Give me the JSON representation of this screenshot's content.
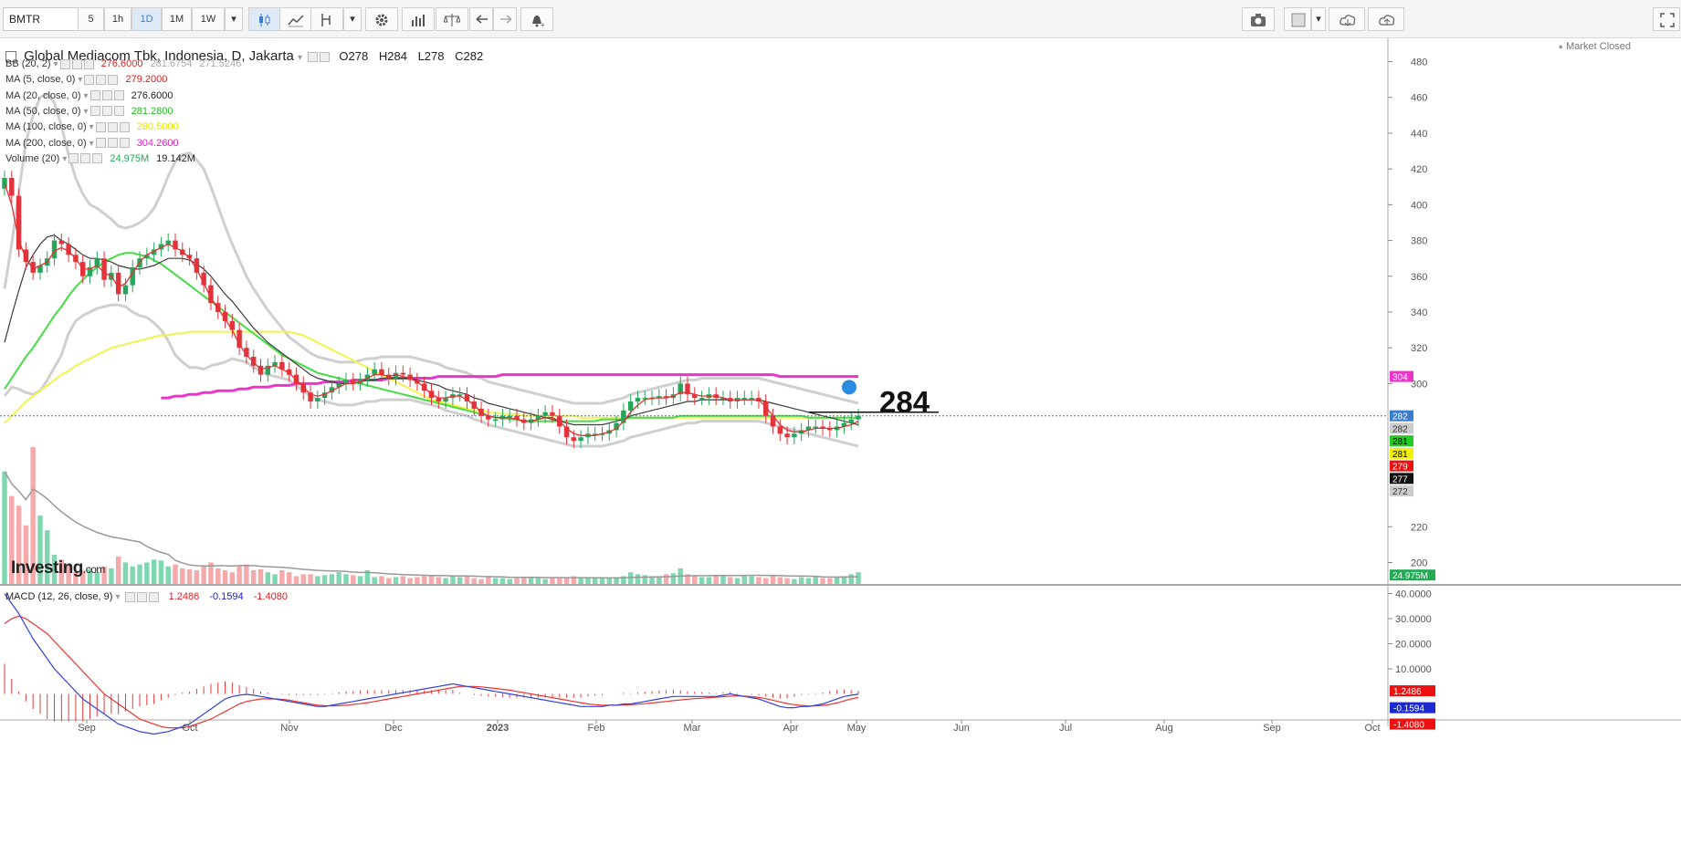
{
  "toolbar": {
    "symbol": "BMTR",
    "intervals": [
      "5",
      "1h",
      "1D",
      "1M",
      "1W"
    ],
    "active_interval": "1D",
    "icons": [
      "candles-icon",
      "line-chart-icon",
      "indicator-icon",
      "settings-icon",
      "studies-icon",
      "compare-icon",
      "undo-icon",
      "redo-icon",
      "alert-icon",
      "camera-icon",
      "color-box-icon",
      "cloud-download-icon",
      "cloud-upload-icon",
      "fullscreen-icon"
    ]
  },
  "header": {
    "title": "Global Mediacom Tbk, Indonesia, D, Jakarta",
    "open": "O278",
    "high": "H284",
    "low": "L278",
    "close": "C282",
    "market_status": "Market Closed"
  },
  "legends": [
    {
      "name": "BB (20, 2)",
      "values": [
        {
          "text": "276.6000",
          "color": "#d82020"
        },
        {
          "text": "281.6754",
          "color": "#aaaaaa"
        },
        {
          "text": "271.5246",
          "color": "#aaaaaa"
        }
      ]
    },
    {
      "name": "MA (5, close, 0)",
      "values": [
        {
          "text": "279.2000",
          "color": "#d82020"
        }
      ]
    },
    {
      "name": "MA (20, close, 0)",
      "values": [
        {
          "text": "276.6000",
          "color": "#222222"
        }
      ]
    },
    {
      "name": "MA (50, close, 0)",
      "values": [
        {
          "text": "281.2800",
          "color": "#22bb22"
        }
      ]
    },
    {
      "name": "MA (100, close, 0)",
      "values": [
        {
          "text": "280.5000",
          "color": "#e6e600"
        }
      ]
    },
    {
      "name": "MA (200, close, 0)",
      "values": [
        {
          "text": "304.2600",
          "color": "#e020c0"
        }
      ]
    },
    {
      "name": "Volume (20)",
      "values": [
        {
          "text": "24.975M",
          "color": "#22aa55"
        },
        {
          "text": "19.142M",
          "color": "#222222"
        }
      ]
    }
  ],
  "macd_legend": {
    "name": "MACD (12, 26, close, 9)",
    "values": [
      {
        "text": "1.2486",
        "color": "#d82020"
      },
      {
        "text": "-0.1594",
        "color": "#2020d0"
      },
      {
        "text": "-1.4080",
        "color": "#d82020"
      }
    ]
  },
  "logo": {
    "main": "Investing",
    "suffix": ".com"
  },
  "annotation": {
    "text": "284",
    "level": 284
  },
  "colors": {
    "up": "#26a65b",
    "down": "#e2343c",
    "ma5": "#e53030",
    "ma20": "#3a3a3a",
    "ma50": "#44dd44",
    "ma100": "#f3f34d",
    "ma200": "#ee33cc",
    "bb": "#cfcfcf",
    "macd": "#3344dd",
    "signal": "#ee3333",
    "vol_up": "#7fd7b0",
    "vol_down": "#f6a9ab",
    "vol_ma": "#999999"
  },
  "chart_data": {
    "type": "candlestick",
    "x_ticks": [
      "Sep",
      "Oct",
      "Nov",
      "Dec",
      "2023",
      "Feb",
      "Mar",
      "Apr",
      "May",
      "Jun",
      "Jul",
      "Aug",
      "Sep",
      "Oct"
    ],
    "price_ticks": [
      480,
      460,
      440,
      420,
      400,
      380,
      360,
      340,
      320,
      300,
      282,
      220,
      200
    ],
    "price_range": [
      188,
      492
    ],
    "macd_ticks": [
      "40.0000",
      "30.0000",
      "20.0000",
      "10.0000"
    ],
    "macd_range": [
      -10,
      42
    ],
    "price_badges": [
      {
        "text": "304",
        "value": 304,
        "bg": "#ee33cc",
        "fg": "#ffffff"
      },
      {
        "text": "282",
        "value": 282,
        "bg": "#3b7ccb",
        "fg": "#ffffff"
      },
      {
        "text": "282",
        "value": 275,
        "bg": "#cccccc",
        "fg": "#333333"
      },
      {
        "text": "281",
        "value": 268,
        "bg": "#22cc22",
        "fg": "#000000"
      },
      {
        "text": "281",
        "value": 261,
        "bg": "#f0f000",
        "fg": "#000000"
      },
      {
        "text": "279",
        "value": 254,
        "bg": "#ee1111",
        "fg": "#ffffff"
      },
      {
        "text": "277",
        "value": 247,
        "bg": "#111111",
        "fg": "#ffffff"
      },
      {
        "text": "272",
        "value": 240,
        "bg": "#cccccc",
        "fg": "#333333"
      },
      {
        "text": "24.975M",
        "value": 193,
        "bg": "#22aa55",
        "fg": "#ffffff"
      }
    ],
    "macd_badges": [
      {
        "text": "1.2486",
        "value": 1.2486,
        "bg": "#ee1111",
        "fg": "#ffffff"
      },
      {
        "text": "-0.1594",
        "value": -5.5,
        "bg": "#1a2ad0",
        "fg": "#ffffff"
      },
      {
        "text": "-1.4080",
        "value": -12,
        "bg": "#ee1111",
        "fg": "#ffffff"
      }
    ],
    "close_prices": [
      415,
      405,
      375,
      368,
      362,
      366,
      370,
      380,
      378,
      372,
      368,
      360,
      365,
      370,
      358,
      362,
      350,
      355,
      365,
      370,
      372,
      375,
      378,
      380,
      375,
      372,
      370,
      362,
      355,
      345,
      340,
      335,
      330,
      320,
      315,
      310,
      305,
      310,
      312,
      308,
      305,
      300,
      295,
      290,
      292,
      295,
      298,
      300,
      302,
      300,
      302,
      305,
      308,
      305,
      303,
      306,
      305,
      302,
      300,
      296,
      292,
      290,
      292,
      294,
      294,
      290,
      286,
      282,
      280,
      280,
      282,
      282,
      280,
      278,
      280,
      282,
      284,
      282,
      276,
      270,
      268,
      270,
      272,
      272,
      272,
      274,
      278,
      285,
      290,
      292,
      292,
      292,
      293,
      292,
      294,
      300,
      294,
      292,
      292,
      294,
      292,
      292,
      290,
      292,
      292,
      292,
      290,
      282,
      276,
      272,
      270,
      272,
      274,
      276,
      276,
      275,
      274,
      276,
      278,
      280,
      282
    ],
    "volumes_m": [
      115,
      90,
      80,
      60,
      140,
      70,
      55,
      30,
      25,
      20,
      12,
      14,
      15,
      12,
      18,
      16,
      28,
      22,
      18,
      20,
      22,
      25,
      24,
      18,
      20,
      16,
      15,
      14,
      18,
      22,
      16,
      14,
      12,
      18,
      20,
      14,
      15,
      12,
      10,
      14,
      12,
      8,
      10,
      10,
      8,
      9,
      10,
      12,
      10,
      9,
      8,
      14,
      7,
      8,
      6,
      7,
      8,
      6,
      7,
      8,
      9,
      7,
      6,
      8,
      7,
      8,
      6,
      5,
      7,
      6,
      6,
      5,
      6,
      7,
      6,
      6,
      5,
      6,
      6,
      7,
      8,
      7,
      6,
      6,
      6,
      6,
      7,
      8,
      12,
      10,
      9,
      8,
      8,
      10,
      11,
      16,
      10,
      8,
      7,
      7,
      9,
      8,
      7,
      6,
      9,
      8,
      7,
      6,
      9,
      7,
      6,
      5,
      7,
      6,
      8,
      6,
      6,
      7,
      8,
      10,
      12
    ],
    "ma5": [
      412,
      400,
      380,
      370,
      364,
      366,
      368,
      374,
      376,
      374,
      370,
      364,
      364,
      366,
      362,
      360,
      354,
      356,
      362,
      368,
      372,
      374,
      376,
      378,
      376,
      374,
      370,
      364,
      356,
      348,
      342,
      336,
      330,
      322,
      316,
      312,
      308,
      309,
      310,
      308,
      306,
      302,
      298,
      294,
      293,
      294,
      296,
      298,
      300,
      300,
      301,
      303,
      305,
      305,
      304,
      305,
      304,
      303,
      301,
      298,
      294,
      292,
      292,
      293,
      293,
      291,
      288,
      284,
      282,
      281,
      281,
      281,
      280,
      279,
      279,
      280,
      281,
      281,
      279,
      275,
      272,
      271,
      271,
      271,
      272,
      273,
      275,
      279,
      284,
      288,
      291,
      292,
      292,
      292,
      293,
      295,
      295,
      294,
      293,
      293,
      293,
      292,
      291,
      291,
      291,
      291,
      291,
      287,
      282,
      277,
      274,
      273,
      273,
      274,
      275,
      275,
      275,
      275,
      276,
      277,
      279
    ],
    "ma20": [
      323,
      338,
      352,
      365,
      372,
      378,
      382,
      383,
      380,
      378,
      375,
      372,
      370,
      370,
      369,
      368,
      366,
      365,
      364,
      364,
      365,
      366,
      368,
      370,
      370,
      370,
      369,
      367,
      364,
      360,
      355,
      350,
      346,
      341,
      336,
      331,
      327,
      323,
      320,
      317,
      314,
      311,
      308,
      305,
      303,
      302,
      301,
      300,
      300,
      300,
      301,
      302,
      302,
      303,
      303,
      303,
      303,
      303,
      302,
      301,
      300,
      299,
      297,
      296,
      295,
      294,
      292,
      291,
      289,
      288,
      287,
      286,
      285,
      284,
      283,
      282,
      281,
      280,
      279,
      278,
      277,
      277,
      277,
      277,
      277,
      278,
      279,
      280,
      282,
      283,
      284,
      285,
      286,
      287,
      288,
      289,
      290,
      290,
      291,
      291,
      291,
      291,
      291,
      291,
      291,
      291,
      291,
      290,
      289,
      288,
      287,
      286,
      285,
      284,
      283,
      282,
      281,
      280,
      279,
      278,
      277
    ],
    "ma50": [
      297,
      303,
      309,
      315,
      320,
      326,
      332,
      338,
      343,
      349,
      354,
      358,
      362,
      365,
      368,
      370,
      372,
      373,
      373,
      372,
      371,
      369,
      367,
      364,
      361,
      358,
      355,
      352,
      349,
      346,
      343,
      340,
      337,
      334,
      331,
      328,
      325,
      322,
      319,
      316,
      314,
      312,
      310,
      308,
      306,
      305,
      304,
      303,
      302,
      301,
      300,
      299,
      298,
      297,
      296,
      295,
      294,
      293,
      292,
      291,
      290,
      289,
      288,
      287,
      286,
      285,
      284,
      283,
      282,
      281,
      281,
      280,
      280,
      279,
      279,
      279,
      279,
      279,
      279,
      279,
      279,
      279,
      279,
      279,
      280,
      280,
      280,
      280,
      281,
      281,
      281,
      281,
      281,
      281,
      281,
      282,
      282,
      282,
      282,
      282,
      282,
      282,
      282,
      282,
      282,
      282,
      282,
      282,
      282,
      282,
      282,
      282,
      282,
      281,
      281,
      281,
      281,
      281,
      281,
      281,
      281
    ],
    "ma100": [
      278,
      282,
      286,
      290,
      293,
      296,
      299,
      302,
      305,
      307,
      310,
      312,
      314,
      316,
      318,
      320,
      321,
      322,
      323,
      324,
      325,
      326,
      327,
      327,
      328,
      328,
      329,
      329,
      329,
      329,
      329,
      329,
      329,
      329,
      329,
      329,
      329,
      329,
      329,
      329,
      329,
      328,
      327,
      325,
      323,
      321,
      319,
      317,
      315,
      313,
      311,
      309,
      307,
      305,
      303,
      301,
      299,
      297,
      295,
      293,
      291,
      290,
      289,
      288,
      287,
      286,
      285,
      285,
      284,
      284,
      283,
      283,
      283,
      282,
      282,
      282,
      282,
      282,
      282,
      282,
      282,
      281,
      281,
      281,
      281,
      281,
      281,
      281,
      281,
      281,
      281,
      281,
      281,
      281,
      281,
      281,
      281,
      281,
      281,
      281,
      281,
      281,
      281,
      281,
      281,
      281,
      281,
      281,
      281,
      281,
      281,
      281,
      281,
      281,
      281,
      281,
      281,
      281,
      281,
      281,
      281
    ],
    "ma200_start_index": 22,
    "ma200": [
      292,
      292,
      293,
      293,
      294,
      294,
      295,
      295,
      296,
      296,
      296,
      297,
      297,
      298,
      298,
      298,
      299,
      299,
      299,
      300,
      300,
      300,
      300,
      301,
      301,
      301,
      301,
      302,
      302,
      302,
      302,
      302,
      303,
      303,
      303,
      303,
      303,
      303,
      303,
      304,
      304,
      304,
      304,
      304,
      304,
      304,
      304,
      304,
      305,
      305,
      305,
      305,
      305,
      305,
      305,
      305,
      305,
      305,
      305,
      305,
      305,
      305,
      305,
      305,
      305,
      305,
      305,
      305,
      305,
      305,
      305,
      305,
      305,
      305,
      305,
      305,
      305,
      305,
      305,
      305,
      305,
      305,
      305,
      305,
      305,
      305,
      305,
      304,
      304,
      304,
      304,
      304,
      304,
      304,
      304,
      304,
      304,
      304,
      304
    ],
    "bb_width": [
      30,
      40,
      55,
      70,
      78,
      82,
      80,
      74,
      64,
      50,
      40,
      34,
      30,
      28,
      26,
      24,
      22,
      22,
      24,
      26,
      28,
      32,
      38,
      46,
      54,
      58,
      60,
      58,
      56,
      50,
      44,
      38,
      32,
      28,
      24,
      22,
      20,
      18,
      16,
      14,
      12,
      12,
      12,
      12,
      12,
      12,
      12,
      12,
      12,
      12,
      12,
      12,
      12,
      12,
      12,
      12,
      12,
      12,
      12,
      12,
      12,
      12,
      12,
      12,
      12,
      12,
      12,
      12,
      12,
      12,
      12,
      12,
      12,
      12,
      12,
      12,
      12,
      12,
      12,
      12,
      12,
      12,
      12,
      12,
      12,
      12,
      12,
      12,
      12,
      12,
      12,
      12,
      12,
      12,
      12,
      12,
      12,
      12,
      12,
      12,
      12,
      12,
      12,
      12,
      12,
      12,
      12,
      12,
      12,
      12,
      12,
      12,
      12,
      12,
      12,
      12,
      12,
      12,
      12,
      12,
      12
    ],
    "macd_line": [
      40,
      36,
      32,
      27,
      22,
      18,
      14,
      10,
      7,
      4,
      1,
      -2,
      -4,
      -6,
      -8,
      -10,
      -12,
      -13,
      -14,
      -15,
      -15.5,
      -16,
      -15.5,
      -15,
      -14,
      -13,
      -12,
      -10,
      -8,
      -6,
      -4,
      -2,
      -1,
      -0.5,
      -0.2,
      -0.5,
      -1,
      -1.5,
      -2,
      -2.5,
      -3,
      -3.5,
      -4,
      -4.5,
      -5,
      -5,
      -4.5,
      -4,
      -3.5,
      -3,
      -2.5,
      -2,
      -1.5,
      -1,
      -0.5,
      0,
      0.5,
      1,
      1.5,
      2,
      2.5,
      3,
      3.5,
      4,
      3.5,
      3,
      2.5,
      2,
      1.5,
      1,
      0.5,
      0,
      -0.5,
      -1,
      -1.5,
      -2,
      -2.5,
      -3,
      -3.5,
      -4,
      -4.5,
      -5,
      -5,
      -5,
      -5,
      -4.5,
      -4.5,
      -4,
      -4,
      -3.5,
      -3,
      -2.5,
      -2,
      -1.5,
      -1,
      -1,
      -1,
      -1,
      -1,
      -1,
      -1,
      -0.5,
      0,
      -0.5,
      -1,
      -1.5,
      -2,
      -3,
      -4,
      -5,
      -5.5,
      -5.5,
      -5,
      -5,
      -4.5,
      -4,
      -3,
      -2,
      -1,
      -0.5,
      -0.16
    ],
    "signal_line": [
      28,
      30,
      31,
      30,
      28,
      26,
      24,
      21,
      18,
      15,
      12,
      9,
      6,
      3,
      0,
      -2,
      -4,
      -6,
      -8,
      -10,
      -11,
      -12,
      -13,
      -13.5,
      -13.5,
      -13.5,
      -13,
      -12,
      -11,
      -10,
      -8.5,
      -7,
      -5.5,
      -4,
      -3,
      -2.5,
      -2,
      -2,
      -2,
      -2.2,
      -2.5,
      -3,
      -3.5,
      -4,
      -4.5,
      -4.7,
      -4.8,
      -4.7,
      -4.5,
      -4.2,
      -3.9,
      -3.5,
      -3,
      -2.5,
      -2,
      -1.5,
      -1,
      -0.5,
      0,
      0.5,
      1,
      1.5,
      2,
      2.5,
      3,
      3,
      3,
      2.8,
      2.5,
      2.2,
      1.8,
      1.5,
      1,
      0.5,
      0,
      -0.5,
      -1,
      -1.5,
      -2,
      -2.5,
      -3,
      -3.5,
      -4,
      -4.3,
      -4.5,
      -4.5,
      -4.5,
      -4.4,
      -4.3,
      -4.1,
      -3.9,
      -3.6,
      -3.3,
      -3,
      -2.7,
      -2.4,
      -2.1,
      -1.9,
      -1.7,
      -1.5,
      -1.3,
      -1.1,
      -0.9,
      -0.8,
      -0.9,
      -1.1,
      -1.4,
      -1.9,
      -2.5,
      -3.2,
      -3.8,
      -4.3,
      -4.6,
      -4.8,
      -4.8,
      -4.6,
      -4.2,
      -3.6,
      -2.8,
      -2,
      -1.4
    ]
  }
}
